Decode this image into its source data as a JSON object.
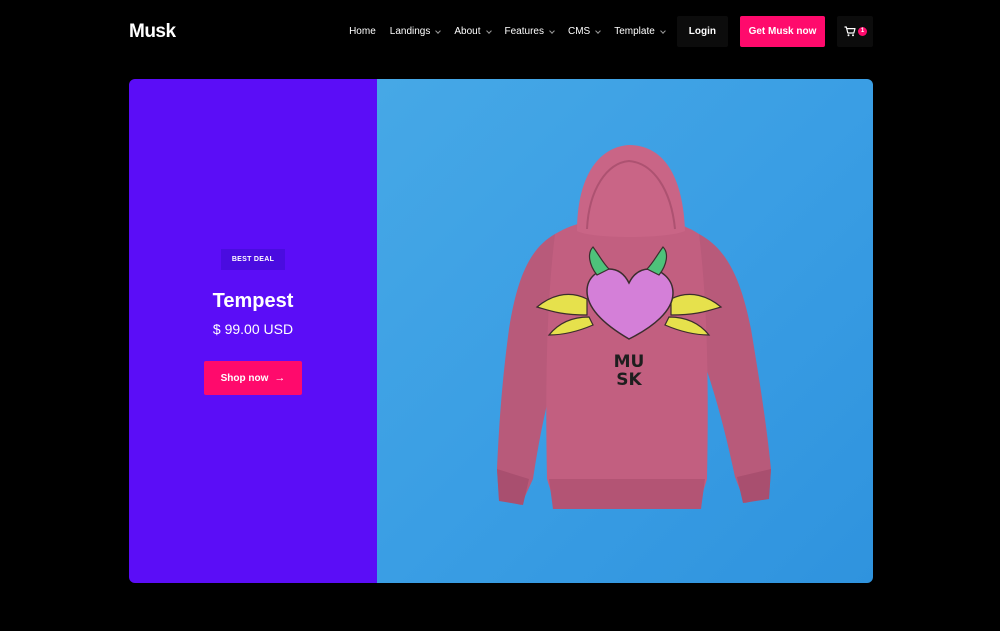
{
  "header": {
    "logo": "Musk",
    "nav": [
      {
        "label": "Home",
        "dropdown": false
      },
      {
        "label": "Landings",
        "dropdown": true
      },
      {
        "label": "About",
        "dropdown": true
      },
      {
        "label": "Features",
        "dropdown": true
      },
      {
        "label": "CMS",
        "dropdown": true
      },
      {
        "label": "Template",
        "dropdown": true
      }
    ],
    "login_label": "Login",
    "cta_label": "Get Musk now",
    "cart_count": "1"
  },
  "hero": {
    "badge": "BEST DEAL",
    "product_name": "Tempest",
    "price": "$ 99.00 USD",
    "shop_label": "Shop now",
    "shop_arrow": "→",
    "print_text_line1": "MU",
    "print_text_line2": "SK"
  },
  "colors": {
    "accent": "#ff0a6c",
    "left_panel": "#5b0df7",
    "right_panel": "#3a9ee4",
    "hoodie": "#c25f80"
  },
  "icons": [
    "cart-icon",
    "arrow-right-icon",
    "chevron-down-icon"
  ]
}
